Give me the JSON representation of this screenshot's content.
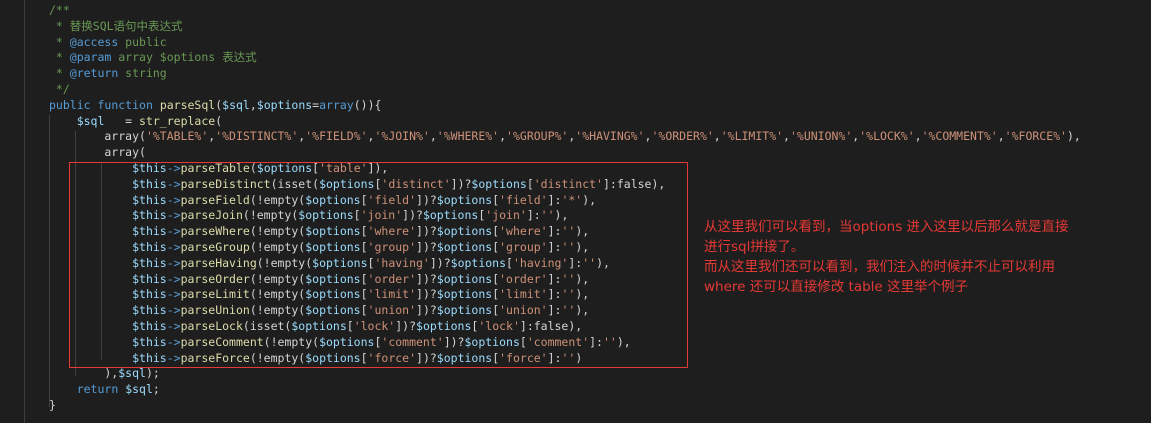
{
  "code": {
    "lines": [
      [
        {
          "c": "c",
          "t": "/**"
        }
      ],
      [
        {
          "c": "c",
          "t": " * 替换SQL语句中表达式"
        }
      ],
      [
        {
          "c": "c",
          "t": " * "
        },
        {
          "c": "at",
          "t": "@access"
        },
        {
          "c": "c",
          "t": " public"
        }
      ],
      [
        {
          "c": "c",
          "t": " * "
        },
        {
          "c": "at",
          "t": "@param"
        },
        {
          "c": "c",
          "t": " array $options 表达式"
        }
      ],
      [
        {
          "c": "c",
          "t": " * "
        },
        {
          "c": "at",
          "t": "@return"
        },
        {
          "c": "c",
          "t": " string"
        }
      ],
      [
        {
          "c": "c",
          "t": " */"
        }
      ],
      [
        {
          "c": "kw",
          "t": "public"
        },
        {
          "c": "pu",
          "t": " "
        },
        {
          "c": "kw",
          "t": "function"
        },
        {
          "c": "pu",
          "t": " "
        },
        {
          "c": "fn",
          "t": "parseSql"
        },
        {
          "c": "pu",
          "t": "("
        },
        {
          "c": "vr",
          "t": "$sql"
        },
        {
          "c": "pu",
          "t": ","
        },
        {
          "c": "vr",
          "t": "$options"
        },
        {
          "c": "pu",
          "t": "="
        },
        {
          "c": "kw",
          "t": "array"
        },
        {
          "c": "pu",
          "t": "()){"
        }
      ],
      [
        {
          "c": "pu",
          "t": "    "
        },
        {
          "c": "vr",
          "t": "$sql"
        },
        {
          "c": "pu",
          "t": "   = "
        },
        {
          "c": "fn",
          "t": "str_replace"
        },
        {
          "c": "pu",
          "t": "("
        }
      ],
      [
        {
          "c": "pu",
          "t": "        array("
        },
        {
          "c": "st",
          "t": "'%TABLE%'"
        },
        {
          "c": "pu",
          "t": ","
        },
        {
          "c": "st",
          "t": "'%DISTINCT%'"
        },
        {
          "c": "pu",
          "t": ","
        },
        {
          "c": "st",
          "t": "'%FIELD%'"
        },
        {
          "c": "pu",
          "t": ","
        },
        {
          "c": "st",
          "t": "'%JOIN%'"
        },
        {
          "c": "pu",
          "t": ","
        },
        {
          "c": "st",
          "t": "'%WHERE%'"
        },
        {
          "c": "pu",
          "t": ","
        },
        {
          "c": "st",
          "t": "'%GROUP%'"
        },
        {
          "c": "pu",
          "t": ","
        },
        {
          "c": "st",
          "t": "'%HAVING%'"
        },
        {
          "c": "pu",
          "t": ","
        },
        {
          "c": "st",
          "t": "'%ORDER%'"
        },
        {
          "c": "pu",
          "t": ","
        },
        {
          "c": "st",
          "t": "'%LIMIT%'"
        },
        {
          "c": "pu",
          "t": ","
        },
        {
          "c": "st",
          "t": "'%UNION%'"
        },
        {
          "c": "pu",
          "t": ","
        },
        {
          "c": "st",
          "t": "'%LOCK%'"
        },
        {
          "c": "pu",
          "t": ","
        },
        {
          "c": "st",
          "t": "'%COMMENT%'"
        },
        {
          "c": "pu",
          "t": ","
        },
        {
          "c": "st",
          "t": "'%FORCE%'"
        },
        {
          "c": "pu",
          "t": "),"
        }
      ],
      [
        {
          "c": "pu",
          "t": "        array("
        }
      ],
      [
        {
          "c": "pu",
          "t": "            "
        },
        {
          "c": "vr",
          "t": "$this"
        },
        {
          "c": "kw",
          "t": "->"
        },
        {
          "c": "fn",
          "t": "parseTable"
        },
        {
          "c": "pu",
          "t": "("
        },
        {
          "c": "vr",
          "t": "$options"
        },
        {
          "c": "pu",
          "t": "["
        },
        {
          "c": "st",
          "t": "'table'"
        },
        {
          "c": "pu",
          "t": "]),"
        }
      ],
      [
        {
          "c": "pu",
          "t": "            "
        },
        {
          "c": "vr",
          "t": "$this"
        },
        {
          "c": "kw",
          "t": "->"
        },
        {
          "c": "fn",
          "t": "parseDistinct"
        },
        {
          "c": "pu",
          "t": "(isset("
        },
        {
          "c": "vr",
          "t": "$options"
        },
        {
          "c": "pu",
          "t": "["
        },
        {
          "c": "st",
          "t": "'distinct'"
        },
        {
          "c": "pu",
          "t": "])?"
        },
        {
          "c": "vr",
          "t": "$options"
        },
        {
          "c": "pu",
          "t": "["
        },
        {
          "c": "st",
          "t": "'distinct'"
        },
        {
          "c": "pu",
          "t": "]:false),"
        }
      ],
      [
        {
          "c": "pu",
          "t": "            "
        },
        {
          "c": "vr",
          "t": "$this"
        },
        {
          "c": "kw",
          "t": "->"
        },
        {
          "c": "fn",
          "t": "parseField"
        },
        {
          "c": "pu",
          "t": "(!empty("
        },
        {
          "c": "vr",
          "t": "$options"
        },
        {
          "c": "pu",
          "t": "["
        },
        {
          "c": "st",
          "t": "'field'"
        },
        {
          "c": "pu",
          "t": "])?"
        },
        {
          "c": "vr",
          "t": "$options"
        },
        {
          "c": "pu",
          "t": "["
        },
        {
          "c": "st",
          "t": "'field'"
        },
        {
          "c": "pu",
          "t": "]:"
        },
        {
          "c": "st",
          "t": "'*'"
        },
        {
          "c": "pu",
          "t": "),"
        }
      ],
      [
        {
          "c": "pu",
          "t": "            "
        },
        {
          "c": "vr",
          "t": "$this"
        },
        {
          "c": "kw",
          "t": "->"
        },
        {
          "c": "fn",
          "t": "parseJoin"
        },
        {
          "c": "pu",
          "t": "(!empty("
        },
        {
          "c": "vr",
          "t": "$options"
        },
        {
          "c": "pu",
          "t": "["
        },
        {
          "c": "st",
          "t": "'join'"
        },
        {
          "c": "pu",
          "t": "])?"
        },
        {
          "c": "vr",
          "t": "$options"
        },
        {
          "c": "pu",
          "t": "["
        },
        {
          "c": "st",
          "t": "'join'"
        },
        {
          "c": "pu",
          "t": "]:"
        },
        {
          "c": "st",
          "t": "''"
        },
        {
          "c": "pu",
          "t": "),"
        }
      ],
      [
        {
          "c": "pu",
          "t": "            "
        },
        {
          "c": "vr",
          "t": "$this"
        },
        {
          "c": "kw",
          "t": "->"
        },
        {
          "c": "fn",
          "t": "parseWhere"
        },
        {
          "c": "pu",
          "t": "(!empty("
        },
        {
          "c": "vr",
          "t": "$options"
        },
        {
          "c": "pu",
          "t": "["
        },
        {
          "c": "st",
          "t": "'where'"
        },
        {
          "c": "pu",
          "t": "])?"
        },
        {
          "c": "vr",
          "t": "$options"
        },
        {
          "c": "pu",
          "t": "["
        },
        {
          "c": "st",
          "t": "'where'"
        },
        {
          "c": "pu",
          "t": "]:"
        },
        {
          "c": "st",
          "t": "''"
        },
        {
          "c": "pu",
          "t": "),"
        }
      ],
      [
        {
          "c": "pu",
          "t": "            "
        },
        {
          "c": "vr",
          "t": "$this"
        },
        {
          "c": "kw",
          "t": "->"
        },
        {
          "c": "fn",
          "t": "parseGroup"
        },
        {
          "c": "pu",
          "t": "(!empty("
        },
        {
          "c": "vr",
          "t": "$options"
        },
        {
          "c": "pu",
          "t": "["
        },
        {
          "c": "st",
          "t": "'group'"
        },
        {
          "c": "pu",
          "t": "])?"
        },
        {
          "c": "vr",
          "t": "$options"
        },
        {
          "c": "pu",
          "t": "["
        },
        {
          "c": "st",
          "t": "'group'"
        },
        {
          "c": "pu",
          "t": "]:"
        },
        {
          "c": "st",
          "t": "''"
        },
        {
          "c": "pu",
          "t": "),"
        }
      ],
      [
        {
          "c": "pu",
          "t": "            "
        },
        {
          "c": "vr",
          "t": "$this"
        },
        {
          "c": "kw",
          "t": "->"
        },
        {
          "c": "fn",
          "t": "parseHaving"
        },
        {
          "c": "pu",
          "t": "(!empty("
        },
        {
          "c": "vr",
          "t": "$options"
        },
        {
          "c": "pu",
          "t": "["
        },
        {
          "c": "st",
          "t": "'having'"
        },
        {
          "c": "pu",
          "t": "])?"
        },
        {
          "c": "vr",
          "t": "$options"
        },
        {
          "c": "pu",
          "t": "["
        },
        {
          "c": "st",
          "t": "'having'"
        },
        {
          "c": "pu",
          "t": "]:"
        },
        {
          "c": "st",
          "t": "''"
        },
        {
          "c": "pu",
          "t": "),"
        }
      ],
      [
        {
          "c": "pu",
          "t": "            "
        },
        {
          "c": "vr",
          "t": "$this"
        },
        {
          "c": "kw",
          "t": "->"
        },
        {
          "c": "fn",
          "t": "parseOrder"
        },
        {
          "c": "pu",
          "t": "(!empty("
        },
        {
          "c": "vr",
          "t": "$options"
        },
        {
          "c": "pu",
          "t": "["
        },
        {
          "c": "st",
          "t": "'order'"
        },
        {
          "c": "pu",
          "t": "])?"
        },
        {
          "c": "vr",
          "t": "$options"
        },
        {
          "c": "pu",
          "t": "["
        },
        {
          "c": "st",
          "t": "'order'"
        },
        {
          "c": "pu",
          "t": "]:"
        },
        {
          "c": "st",
          "t": "''"
        },
        {
          "c": "pu",
          "t": "),"
        }
      ],
      [
        {
          "c": "pu",
          "t": "            "
        },
        {
          "c": "vr",
          "t": "$this"
        },
        {
          "c": "kw",
          "t": "->"
        },
        {
          "c": "fn",
          "t": "parseLimit"
        },
        {
          "c": "pu",
          "t": "(!empty("
        },
        {
          "c": "vr",
          "t": "$options"
        },
        {
          "c": "pu",
          "t": "["
        },
        {
          "c": "st",
          "t": "'limit'"
        },
        {
          "c": "pu",
          "t": "])?"
        },
        {
          "c": "vr",
          "t": "$options"
        },
        {
          "c": "pu",
          "t": "["
        },
        {
          "c": "st",
          "t": "'limit'"
        },
        {
          "c": "pu",
          "t": "]:"
        },
        {
          "c": "st",
          "t": "''"
        },
        {
          "c": "pu",
          "t": "),"
        }
      ],
      [
        {
          "c": "pu",
          "t": "            "
        },
        {
          "c": "vr",
          "t": "$this"
        },
        {
          "c": "kw",
          "t": "->"
        },
        {
          "c": "fn",
          "t": "parseUnion"
        },
        {
          "c": "pu",
          "t": "(!empty("
        },
        {
          "c": "vr",
          "t": "$options"
        },
        {
          "c": "pu",
          "t": "["
        },
        {
          "c": "st",
          "t": "'union'"
        },
        {
          "c": "pu",
          "t": "])?"
        },
        {
          "c": "vr",
          "t": "$options"
        },
        {
          "c": "pu",
          "t": "["
        },
        {
          "c": "st",
          "t": "'union'"
        },
        {
          "c": "pu",
          "t": "]:"
        },
        {
          "c": "st",
          "t": "''"
        },
        {
          "c": "pu",
          "t": "),"
        }
      ],
      [
        {
          "c": "pu",
          "t": "            "
        },
        {
          "c": "vr",
          "t": "$this"
        },
        {
          "c": "kw",
          "t": "->"
        },
        {
          "c": "fn",
          "t": "parseLock"
        },
        {
          "c": "pu",
          "t": "(isset("
        },
        {
          "c": "vr",
          "t": "$options"
        },
        {
          "c": "pu",
          "t": "["
        },
        {
          "c": "st",
          "t": "'lock'"
        },
        {
          "c": "pu",
          "t": "])?"
        },
        {
          "c": "vr",
          "t": "$options"
        },
        {
          "c": "pu",
          "t": "["
        },
        {
          "c": "st",
          "t": "'lock'"
        },
        {
          "c": "pu",
          "t": "]:false),"
        }
      ],
      [
        {
          "c": "pu",
          "t": "            "
        },
        {
          "c": "vr",
          "t": "$this"
        },
        {
          "c": "kw",
          "t": "->"
        },
        {
          "c": "fn",
          "t": "parseComment"
        },
        {
          "c": "pu",
          "t": "(!empty("
        },
        {
          "c": "vr",
          "t": "$options"
        },
        {
          "c": "pu",
          "t": "["
        },
        {
          "c": "st",
          "t": "'comment'"
        },
        {
          "c": "pu",
          "t": "])?"
        },
        {
          "c": "vr",
          "t": "$options"
        },
        {
          "c": "pu",
          "t": "["
        },
        {
          "c": "st",
          "t": "'comment'"
        },
        {
          "c": "pu",
          "t": "]:"
        },
        {
          "c": "st",
          "t": "''"
        },
        {
          "c": "pu",
          "t": "),"
        }
      ],
      [
        {
          "c": "pu",
          "t": "            "
        },
        {
          "c": "vr",
          "t": "$this"
        },
        {
          "c": "kw",
          "t": "->"
        },
        {
          "c": "fn",
          "t": "parseForce"
        },
        {
          "c": "pu",
          "t": "(!empty("
        },
        {
          "c": "vr",
          "t": "$options"
        },
        {
          "c": "pu",
          "t": "["
        },
        {
          "c": "st",
          "t": "'force'"
        },
        {
          "c": "pu",
          "t": "])?"
        },
        {
          "c": "vr",
          "t": "$options"
        },
        {
          "c": "pu",
          "t": "["
        },
        {
          "c": "st",
          "t": "'force'"
        },
        {
          "c": "pu",
          "t": "]:"
        },
        {
          "c": "st",
          "t": "''"
        },
        {
          "c": "pu",
          "t": ")"
        }
      ],
      [
        {
          "c": "pu",
          "t": "        ),"
        },
        {
          "c": "vr",
          "t": "$sql"
        },
        {
          "c": "pu",
          "t": ");"
        }
      ],
      [
        {
          "c": "pu",
          "t": "    "
        },
        {
          "c": "kw",
          "t": "return"
        },
        {
          "c": "pu",
          "t": " "
        },
        {
          "c": "vr",
          "t": "$sql"
        },
        {
          "c": "pu",
          "t": ";"
        }
      ],
      [
        {
          "c": "pu",
          "t": "}"
        }
      ]
    ]
  },
  "annotation": {
    "line1": "从这里我们可以看到，当options 进入这里以后那么就是直接",
    "line2": "进行sql拼接了。",
    "line3": "而从这里我们还可以看到，我们注入的时候并不止可以利用",
    "line4": "where  还可以直接修改 table 这里举个例子",
    "color": "#e53935"
  },
  "theme": {
    "background": "#1e1e1e",
    "comment": "#6a9955",
    "keyword": "#569cd6",
    "function": "#dcdcaa",
    "variable": "#9cdcfe",
    "string": "#ce9178"
  }
}
